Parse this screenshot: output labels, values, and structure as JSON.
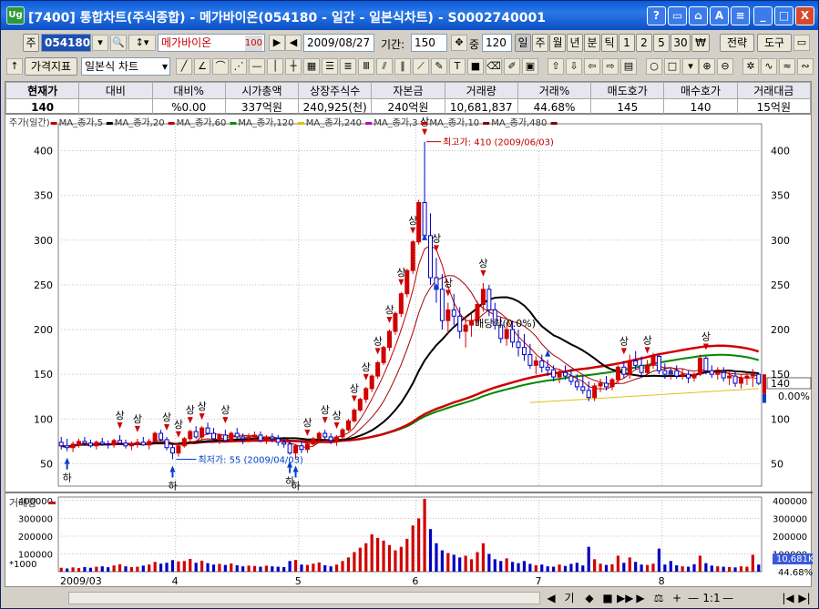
{
  "window": {
    "title": "[7400] 통합차트(주식종합) - 메가바이온(054180 - 일간 - 일본식차트) - S0002740001",
    "app_icon": "Ug",
    "buttons": [
      "?",
      "▭",
      "⌂",
      "A",
      "≡",
      "_",
      "□",
      "X"
    ]
  },
  "toolbar1": {
    "market_type": "주",
    "code": "054180",
    "name": "메가바이온",
    "name_suffix": "100",
    "date": "2009/08/27",
    "period_label": "기간:",
    "period_value": "150",
    "count_label": "중",
    "count_value": "120",
    "period_buttons": [
      "일",
      "주",
      "월",
      "년",
      "분",
      "틱",
      "1",
      "2",
      "5",
      "30",
      "₩"
    ],
    "strategy": "전략",
    "tools": "도구"
  },
  "toolbar2": {
    "indicator": "가격지표",
    "chart_type": "일본식 차트"
  },
  "quote": {
    "headers": [
      "현재가",
      "대비",
      "대비%",
      "시가총액",
      "상장주식수",
      "자본금",
      "거래량",
      "거래%",
      "매도호가",
      "매수호가",
      "거래대금"
    ],
    "values": [
      "140",
      "",
      "%0.00",
      "337억원",
      "240,925(천)",
      "240억원",
      "10,681,837",
      "44.68%",
      "145",
      "140",
      "15억원"
    ]
  },
  "chart_data": {
    "type": "candlestick",
    "price_legend": [
      {
        "name": "주가(일간)",
        "color": "#000000"
      },
      {
        "name": "MA_종가,5",
        "color": "#c00000"
      },
      {
        "name": "MA_종가,20",
        "color": "#000000"
      },
      {
        "name": "MA_종가,60",
        "color": "#c00000"
      },
      {
        "name": "MA_종가,120",
        "color": "#009000"
      },
      {
        "name": "MA_종가,240",
        "color": "#e0c000"
      },
      {
        "name": "MA_종가,3",
        "color": "#c000c0"
      },
      {
        "name": "MA_종가,10",
        "color": "#c00000"
      },
      {
        "name": "MA_종가,480",
        "color": "#800000"
      }
    ],
    "volume_legend": "거래량",
    "volume_unit": "*1000",
    "y_ticks": [
      50,
      100,
      150,
      200,
      250,
      300,
      350,
      400
    ],
    "ylim": [
      25,
      430
    ],
    "vol_ticks": [
      100000,
      200000,
      300000,
      400000
    ],
    "vol_ticks_labels": [
      "100000",
      "200000",
      "300000",
      "400000"
    ],
    "x_labels": [
      "2009/03",
      "4",
      "5",
      "6",
      "7",
      "8"
    ],
    "x_label_days": [
      0,
      20,
      41,
      61,
      82,
      103
    ],
    "days": 120,
    "current_price": "140",
    "current_pct": "0.00%",
    "current_volume": "10,681K",
    "current_volume_pct": "44.68%",
    "high_label": "최고가: 410 (2009/06/03)",
    "low_label": "최저가: 55 (2009/04/03)",
    "mid_label": "배당락(0.0%)",
    "up_mark": "상",
    "down_mark": "하",
    "colors": {
      "up": "#d00000",
      "down": "#0000c0",
      "ma5": "#c00000",
      "ma20": "#000000",
      "ma60": "#cc0000",
      "ma120": "#008800",
      "ma240": "#e0c020"
    },
    "ohlc": [
      [
        74,
        80,
        66,
        70
      ],
      [
        70,
        78,
        64,
        68
      ],
      [
        68,
        75,
        63,
        72
      ],
      [
        72,
        78,
        68,
        75
      ],
      [
        75,
        80,
        70,
        73
      ],
      [
        73,
        77,
        68,
        70
      ],
      [
        70,
        76,
        66,
        74
      ],
      [
        74,
        79,
        70,
        72
      ],
      [
        72,
        76,
        67,
        71
      ],
      [
        71,
        78,
        68,
        76
      ],
      [
        76,
        82,
        72,
        73
      ],
      [
        73,
        77,
        67,
        70
      ],
      [
        70,
        75,
        65,
        72
      ],
      [
        72,
        78,
        68,
        74
      ],
      [
        74,
        80,
        70,
        71
      ],
      [
        71,
        78,
        66,
        75
      ],
      [
        75,
        86,
        73,
        84
      ],
      [
        84,
        88,
        75,
        77
      ],
      [
        77,
        80,
        65,
        68
      ],
      [
        68,
        72,
        55,
        62
      ],
      [
        62,
        72,
        58,
        70
      ],
      [
        70,
        80,
        68,
        78
      ],
      [
        78,
        88,
        75,
        86
      ],
      [
        86,
        92,
        78,
        80
      ],
      [
        80,
        92,
        76,
        90
      ],
      [
        90,
        96,
        82,
        84
      ],
      [
        84,
        90,
        76,
        78
      ],
      [
        78,
        84,
        72,
        82
      ],
      [
        82,
        88,
        74,
        76
      ],
      [
        76,
        86,
        74,
        84
      ],
      [
        84,
        90,
        78,
        80
      ],
      [
        80,
        84,
        72,
        78
      ],
      [
        78,
        84,
        74,
        80
      ],
      [
        80,
        86,
        76,
        82
      ],
      [
        82,
        86,
        74,
        76
      ],
      [
        76,
        82,
        72,
        80
      ],
      [
        80,
        84,
        74,
        78
      ],
      [
        78,
        82,
        70,
        74
      ],
      [
        74,
        80,
        68,
        72
      ],
      [
        72,
        76,
        60,
        62
      ],
      [
        62,
        72,
        55,
        70
      ],
      [
        70,
        76,
        62,
        66
      ],
      [
        66,
        74,
        62,
        72
      ],
      [
        72,
        80,
        70,
        78
      ],
      [
        78,
        86,
        74,
        84
      ],
      [
        84,
        88,
        76,
        80
      ],
      [
        80,
        84,
        72,
        76
      ],
      [
        76,
        82,
        70,
        80
      ],
      [
        80,
        90,
        76,
        88
      ],
      [
        88,
        100,
        86,
        98
      ],
      [
        98,
        112,
        96,
        110
      ],
      [
        110,
        124,
        108,
        122
      ],
      [
        122,
        136,
        118,
        134
      ],
      [
        134,
        150,
        130,
        148
      ],
      [
        148,
        165,
        145,
        163
      ],
      [
        163,
        182,
        160,
        180
      ],
      [
        180,
        200,
        176,
        198
      ],
      [
        198,
        220,
        194,
        218
      ],
      [
        218,
        242,
        214,
        240
      ],
      [
        240,
        268,
        236,
        266
      ],
      [
        266,
        300,
        262,
        298
      ],
      [
        298,
        345,
        295,
        342
      ],
      [
        342,
        410,
        300,
        305
      ],
      [
        305,
        330,
        250,
        258
      ],
      [
        258,
        280,
        230,
        245
      ],
      [
        245,
        262,
        200,
        210
      ],
      [
        210,
        230,
        195,
        222
      ],
      [
        222,
        240,
        205,
        215
      ],
      [
        215,
        225,
        190,
        198
      ],
      [
        198,
        215,
        180,
        205
      ],
      [
        205,
        218,
        192,
        210
      ],
      [
        210,
        232,
        205,
        228
      ],
      [
        228,
        252,
        220,
        245
      ],
      [
        245,
        250,
        215,
        222
      ],
      [
        222,
        230,
        200,
        205
      ],
      [
        205,
        214,
        185,
        190
      ],
      [
        190,
        208,
        182,
        200
      ],
      [
        200,
        210,
        180,
        186
      ],
      [
        186,
        200,
        170,
        180
      ],
      [
        180,
        195,
        165,
        172
      ],
      [
        172,
        184,
        156,
        160
      ],
      [
        160,
        170,
        150,
        165
      ],
      [
        165,
        172,
        152,
        158
      ],
      [
        158,
        166,
        148,
        155
      ],
      [
        155,
        160,
        142,
        147
      ],
      [
        147,
        156,
        140,
        152
      ],
      [
        152,
        160,
        144,
        148
      ],
      [
        148,
        156,
        138,
        142
      ],
      [
        142,
        150,
        132,
        136
      ],
      [
        136,
        148,
        128,
        132
      ],
      [
        132,
        142,
        120,
        124
      ],
      [
        124,
        140,
        120,
        137
      ],
      [
        137,
        145,
        130,
        140
      ],
      [
        140,
        148,
        132,
        136
      ],
      [
        136,
        146,
        132,
        144
      ],
      [
        144,
        160,
        140,
        158
      ],
      [
        158,
        165,
        146,
        150
      ],
      [
        150,
        172,
        145,
        165
      ],
      [
        165,
        176,
        155,
        160
      ],
      [
        160,
        170,
        148,
        152
      ],
      [
        152,
        166,
        148,
        160
      ],
      [
        160,
        174,
        156,
        170
      ],
      [
        170,
        172,
        150,
        154
      ],
      [
        154,
        162,
        145,
        150
      ],
      [
        150,
        158,
        144,
        154
      ],
      [
        154,
        160,
        145,
        148
      ],
      [
        148,
        156,
        144,
        150
      ],
      [
        150,
        154,
        140,
        146
      ],
      [
        146,
        152,
        142,
        150
      ],
      [
        150,
        172,
        148,
        168
      ],
      [
        168,
        170,
        150,
        154
      ],
      [
        154,
        160,
        146,
        150
      ],
      [
        150,
        158,
        144,
        152
      ],
      [
        152,
        158,
        142,
        146
      ],
      [
        146,
        154,
        138,
        148
      ],
      [
        148,
        154,
        136,
        140
      ],
      [
        140,
        150,
        134,
        146
      ],
      [
        146,
        152,
        138,
        148
      ],
      [
        148,
        156,
        136,
        150
      ],
      [
        150,
        152,
        138,
        140
      ]
    ],
    "volume": [
      [
        22,
        1
      ],
      [
        18,
        0
      ],
      [
        24,
        1
      ],
      [
        20,
        1
      ],
      [
        26,
        0
      ],
      [
        22,
        0
      ],
      [
        28,
        1
      ],
      [
        30,
        0
      ],
      [
        25,
        0
      ],
      [
        35,
        1
      ],
      [
        42,
        1
      ],
      [
        30,
        0
      ],
      [
        26,
        1
      ],
      [
        28,
        1
      ],
      [
        34,
        0
      ],
      [
        40,
        1
      ],
      [
        55,
        1
      ],
      [
        45,
        0
      ],
      [
        50,
        0
      ],
      [
        65,
        0
      ],
      [
        58,
        1
      ],
      [
        60,
        1
      ],
      [
        72,
        1
      ],
      [
        50,
        0
      ],
      [
        62,
        1
      ],
      [
        48,
        0
      ],
      [
        40,
        0
      ],
      [
        44,
        1
      ],
      [
        38,
        0
      ],
      [
        46,
        1
      ],
      [
        36,
        0
      ],
      [
        30,
        0
      ],
      [
        34,
        1
      ],
      [
        32,
        1
      ],
      [
        28,
        0
      ],
      [
        34,
        1
      ],
      [
        30,
        0
      ],
      [
        28,
        0
      ],
      [
        26,
        0
      ],
      [
        60,
        0
      ],
      [
        66,
        1
      ],
      [
        40,
        0
      ],
      [
        38,
        1
      ],
      [
        45,
        1
      ],
      [
        52,
        1
      ],
      [
        36,
        0
      ],
      [
        30,
        0
      ],
      [
        40,
        1
      ],
      [
        60,
        1
      ],
      [
        80,
        1
      ],
      [
        110,
        1
      ],
      [
        135,
        1
      ],
      [
        160,
        1
      ],
      [
        210,
        1
      ],
      [
        190,
        1
      ],
      [
        175,
        1
      ],
      [
        150,
        1
      ],
      [
        120,
        1
      ],
      [
        140,
        1
      ],
      [
        185,
        1
      ],
      [
        260,
        1
      ],
      [
        300,
        1
      ],
      [
        410,
        1
      ],
      [
        240,
        0
      ],
      [
        160,
        0
      ],
      [
        120,
        0
      ],
      [
        105,
        1
      ],
      [
        95,
        0
      ],
      [
        80,
        0
      ],
      [
        90,
        1
      ],
      [
        70,
        1
      ],
      [
        110,
        1
      ],
      [
        160,
        1
      ],
      [
        100,
        0
      ],
      [
        70,
        0
      ],
      [
        60,
        0
      ],
      [
        75,
        1
      ],
      [
        55,
        0
      ],
      [
        48,
        0
      ],
      [
        60,
        0
      ],
      [
        44,
        0
      ],
      [
        36,
        1
      ],
      [
        40,
        0
      ],
      [
        30,
        0
      ],
      [
        28,
        0
      ],
      [
        40,
        1
      ],
      [
        32,
        0
      ],
      [
        44,
        0
      ],
      [
        50,
        0
      ],
      [
        35,
        0
      ],
      [
        140,
        0
      ],
      [
        70,
        1
      ],
      [
        45,
        1
      ],
      [
        38,
        0
      ],
      [
        42,
        1
      ],
      [
        90,
        1
      ],
      [
        50,
        0
      ],
      [
        80,
        1
      ],
      [
        55,
        0
      ],
      [
        40,
        0
      ],
      [
        38,
        1
      ],
      [
        45,
        1
      ],
      [
        130,
        0
      ],
      [
        40,
        0
      ],
      [
        60,
        0
      ],
      [
        36,
        0
      ],
      [
        30,
        1
      ],
      [
        28,
        0
      ],
      [
        42,
        0
      ],
      [
        90,
        1
      ],
      [
        48,
        0
      ],
      [
        34,
        0
      ],
      [
        30,
        1
      ],
      [
        28,
        0
      ],
      [
        26,
        1
      ],
      [
        24,
        0
      ],
      [
        30,
        1
      ],
      [
        28,
        1
      ],
      [
        95,
        1
      ],
      [
        40,
        0
      ]
    ]
  },
  "statusbar": {
    "buttons": [
      "◀",
      "기",
      "◆",
      "■",
      "▶▶",
      "▶",
      "⚖",
      "+",
      "—",
      "1:1",
      "—",
      "|◀",
      "▶|"
    ]
  }
}
